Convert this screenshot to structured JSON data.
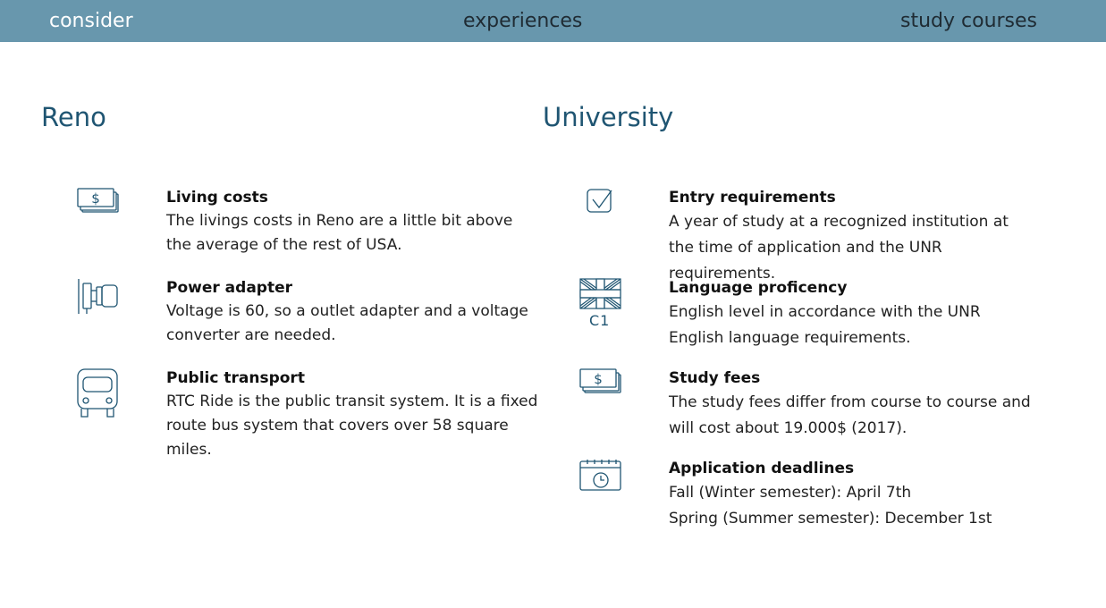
{
  "nav": {
    "consider": "consider",
    "experiences": "experiences",
    "study_courses": "study courses"
  },
  "reno": {
    "title": "Reno",
    "items": [
      {
        "icon": "money-stack-icon",
        "heading": "Living costs",
        "text": "The livings costs in Reno are a little bit above the average of the rest of USA."
      },
      {
        "icon": "power-adapter-icon",
        "heading": "Power adapter",
        "text": "Voltage is 60, so a outlet adapter and a voltage converter are needed."
      },
      {
        "icon": "bus-icon",
        "heading": "Public transport",
        "text": "RTC Ride is the public transit system. It is a fixed route bus system that covers over 58 square miles."
      }
    ]
  },
  "university": {
    "title": "University",
    "items": [
      {
        "icon": "checkbox-icon",
        "heading": "Entry requirements",
        "text": "A year of study at a recognized institution at the time of application and the UNR requirements."
      },
      {
        "icon": "uk-flag-icon",
        "icon_label": "C1",
        "heading": "Language proficency",
        "text": "English level in accordance with the UNR English language requirements."
      },
      {
        "icon": "money-stack-icon",
        "heading": "Study fees",
        "text": "The study fees differ from course to course and will cost about 19.000$ (2017)."
      },
      {
        "icon": "calendar-clock-icon",
        "heading": "Application deadlines",
        "lines": [
          "Fall (Winter semester): April 7th",
          "Spring (Summer semester): December 1st"
        ]
      }
    ]
  },
  "colors": {
    "topbar": "#6897ad",
    "accent": "#1f5572",
    "nav_active": "#ffffff",
    "nav_text": "#1f2b33"
  }
}
